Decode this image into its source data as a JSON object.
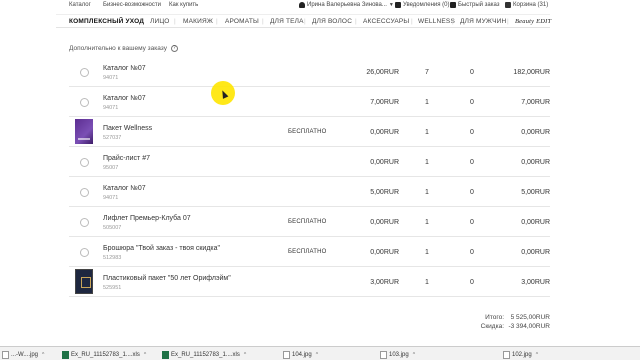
{
  "topbar": {
    "left_links": [
      "Каталог",
      "Бизнес-возможности",
      "Как купить"
    ],
    "user_name": "Ирина Валерьевна Зинова...",
    "notifications": "Уведомления (0)",
    "quick_order": "Быстрый заказ",
    "cart": "Корзина (31)"
  },
  "catnav": {
    "items": [
      "КОМПЛЕКСНЫЙ УХОД",
      "ЛИЦО",
      "МАКИЯЖ",
      "АРОМАТЫ",
      "ДЛЯ ТЕЛА",
      "ДЛЯ ВОЛОС",
      "АКСЕССУАРЫ",
      "WELLNESS",
      "ДЛЯ МУЖЧИН"
    ],
    "brand": "Beauty EDIT"
  },
  "section": {
    "title": "Дополнительно к вашему заказу",
    "help": "?"
  },
  "items": [
    {
      "name": "Каталог №07",
      "code": "94071",
      "free": "",
      "price": "26,00RUR",
      "qty": "7",
      "discount": "0",
      "total": "182,00RUR",
      "thumb": "radio"
    },
    {
      "name": "Каталог №07",
      "code": "94071",
      "free": "",
      "price": "7,00RUR",
      "qty": "1",
      "discount": "0",
      "total": "7,00RUR",
      "thumb": "radio"
    },
    {
      "name": "Пакет Wellness",
      "code": "527037",
      "free": "БЕСПЛАТНО",
      "price": "0,00RUR",
      "qty": "1",
      "discount": "0",
      "total": "0,00RUR",
      "thumb": "purple"
    },
    {
      "name": "Прайс-лист #7",
      "code": "95007",
      "free": "",
      "price": "0,00RUR",
      "qty": "1",
      "discount": "0",
      "total": "0,00RUR",
      "thumb": "radio"
    },
    {
      "name": "Каталог №07",
      "code": "94071",
      "free": "",
      "price": "5,00RUR",
      "qty": "1",
      "discount": "0",
      "total": "5,00RUR",
      "thumb": "radio"
    },
    {
      "name": "Лифлет Премьер-Клуба 07",
      "code": "505007",
      "free": "БЕСПЛАТНО",
      "price": "0,00RUR",
      "qty": "1",
      "discount": "0",
      "total": "0,00RUR",
      "thumb": "radio"
    },
    {
      "name": "Брошюра \"Твой заказ - твоя скидка\"",
      "code": "512983",
      "free": "БЕСПЛАТНО",
      "price": "0,00RUR",
      "qty": "1",
      "discount": "0",
      "total": "0,00RUR",
      "thumb": "radio"
    },
    {
      "name": "Пластиковый пакет \"50 лет Орифлэйм\"",
      "code": "525951",
      "free": "",
      "price": "3,00RUR",
      "qty": "1",
      "discount": "0",
      "total": "3,00RUR",
      "thumb": "navy"
    }
  ],
  "totals": {
    "total_label": "Итого:",
    "total_value": "5 525,00RUR",
    "discount_label": "Скидка:",
    "discount_value": "-3 394,00RUR"
  },
  "downloads": [
    "...-W....jpg",
    "Ex_RU_11152783_1....xls",
    "Ex_RU_11152783_1....xls",
    "104.jpg",
    "103.jpg",
    "102.jpg"
  ]
}
